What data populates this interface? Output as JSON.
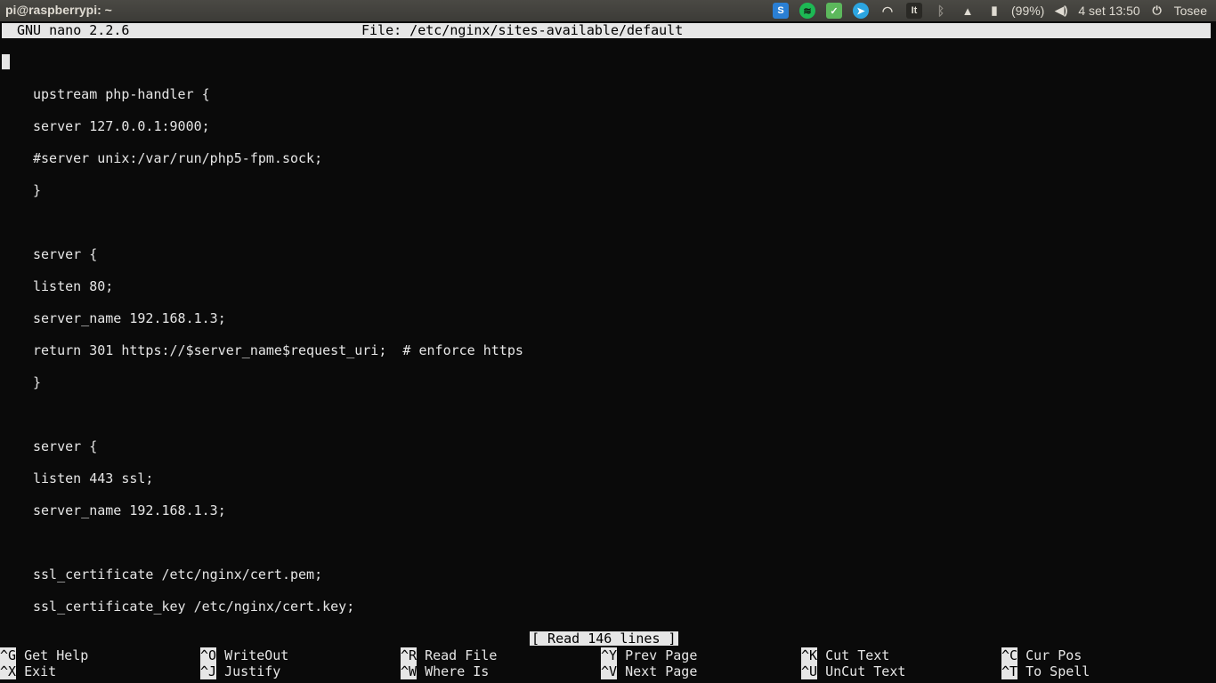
{
  "panel": {
    "window_title": "pi@raspberrypi: ~",
    "battery": "(99%)",
    "datetime": "4 set 13:50",
    "user": "Tosee",
    "icons": [
      "skype-icon",
      "spotify-icon",
      "check-app-icon",
      "telegram-icon",
      "wifi-icon",
      "keyboard-layout-icon",
      "bluetooth-icon",
      "notification-icon",
      "battery-icon",
      "volume-icon",
      "session-icon"
    ],
    "keyboard_layout": "It"
  },
  "nano": {
    "version": "GNU nano 2.2.6",
    "file": "File: /etc/nginx/sites-available/default",
    "status": "[ Read 146 lines ]",
    "lines": [
      "upstream php-handler {",
      "server 127.0.0.1:9000;",
      "#server unix:/var/run/php5-fpm.sock;",
      "}",
      "server {",
      "listen 80;",
      "server_name 192.168.1.3;",
      "return 301 https://$server_name$request_uri;  # enforce https",
      "}",
      "server {",
      "listen 443 ssl;",
      "server_name 192.168.1.3;",
      "ssl_certificate /etc/nginx/cert.pem;",
      "ssl_certificate_key /etc/nginx/cert.key;"
    ],
    "shortcuts": [
      {
        "key": "^G",
        "label": "Get Help"
      },
      {
        "key": "^O",
        "label": "WriteOut"
      },
      {
        "key": "^R",
        "label": "Read File"
      },
      {
        "key": "^Y",
        "label": "Prev Page"
      },
      {
        "key": "^K",
        "label": "Cut Text"
      },
      {
        "key": "^C",
        "label": "Cur Pos"
      },
      {
        "key": "^X",
        "label": "Exit"
      },
      {
        "key": "^J",
        "label": "Justify"
      },
      {
        "key": "^W",
        "label": "Where Is"
      },
      {
        "key": "^V",
        "label": "Next Page"
      },
      {
        "key": "^U",
        "label": "UnCut Text"
      },
      {
        "key": "^T",
        "label": "To Spell"
      }
    ]
  },
  "colors": {
    "panel_bg": "#3c3b37",
    "terminal_bg": "#0a0a0a",
    "terminal_fg": "#e6e6e6"
  }
}
